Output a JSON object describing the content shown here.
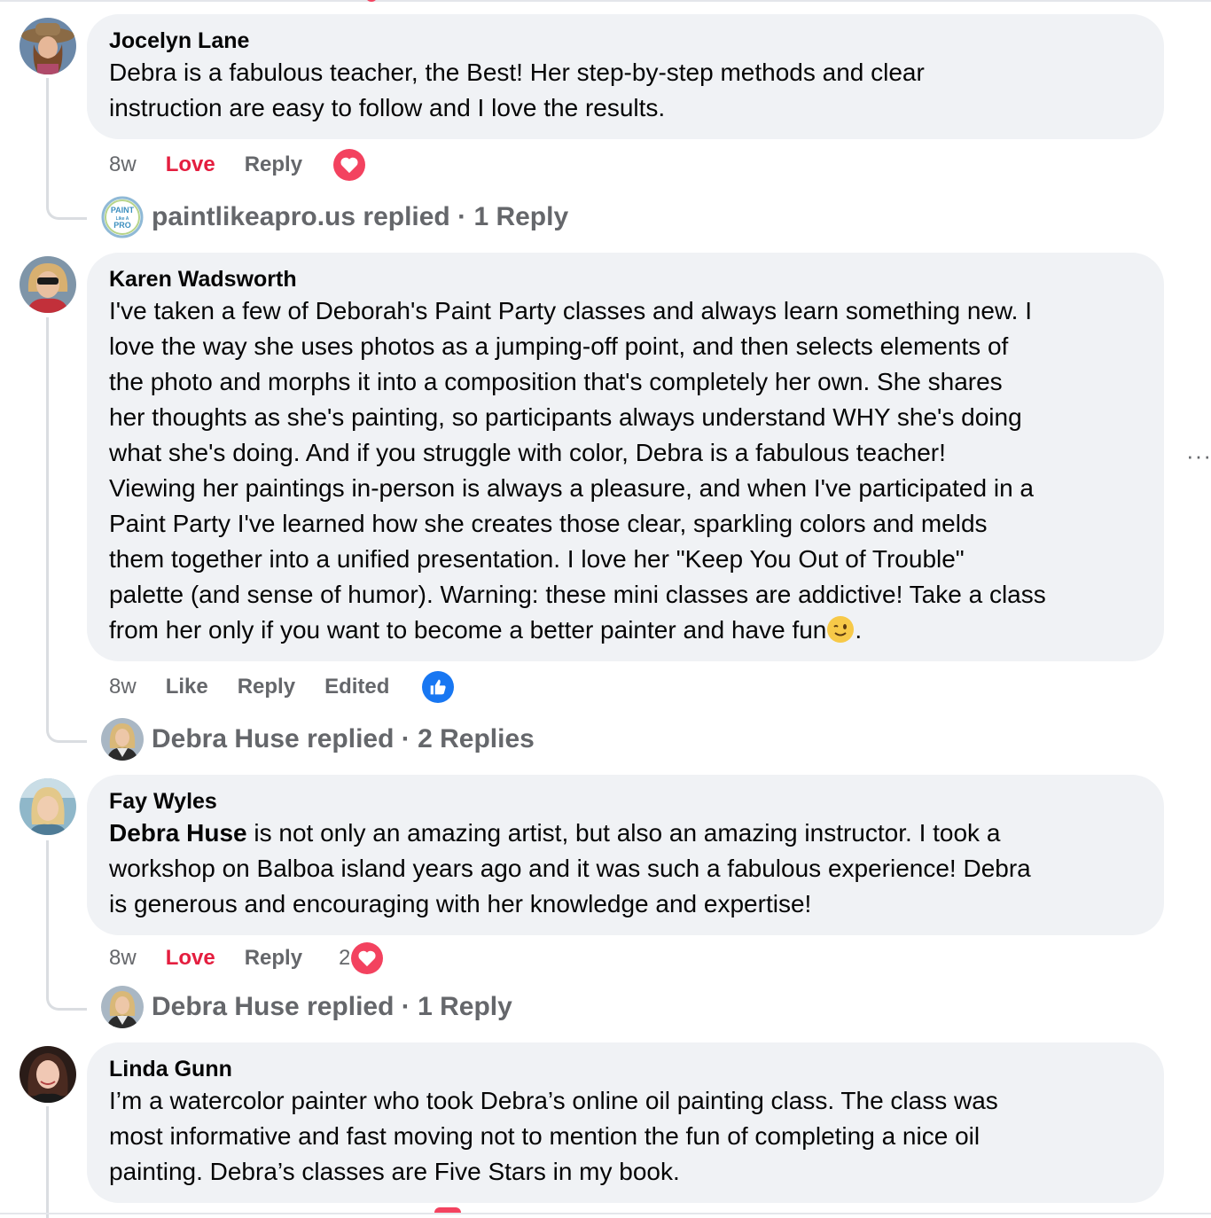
{
  "comments": [
    {
      "author": "Jocelyn Lane",
      "text": "Debra is a fabulous teacher, the Best! Her step-by-step methods and clear\ninstruction are easy to follow and I love the results.",
      "time": "8w",
      "reaction_action": "Love",
      "reply_action": "Reply",
      "reaction_icon": "heart",
      "reaction_count": "",
      "replied_by": "paintlikeapro.us replied",
      "reply_count": "1 Reply"
    },
    {
      "author": "Karen Wadsworth",
      "text": "I've taken a few of Deborah's Paint Party classes and always learn something new. I\nlove the way she uses photos as a jumping-off point, and then selects elements of\nthe photo and morphs it into a composition that's completely her own. She shares\nher thoughts as she's painting, so participants always understand WHY she's doing\nwhat she's doing. And if you struggle with color, Debra is a fabulous teacher!\nViewing her paintings in-person is always a pleasure, and when I've participated in a\nPaint Party I've learned how she creates those clear, sparkling colors and melds\nthem together into a unified presentation. I love her \"Keep You Out of Trouble\"\npalette (and sense of humor). Warning: these mini classes are addictive! Take a class\nfrom her only if you want to become a better painter and have fun",
      "text_end": ".",
      "time": "8w",
      "reaction_action": "Like",
      "reply_action": "Reply",
      "edited": "Edited",
      "reaction_icon": "thumbs-up",
      "reaction_count": "",
      "replied_by": "Debra Huse replied",
      "reply_count": "2 Replies"
    },
    {
      "author": "Fay Wyles",
      "mention": "Debra Huse",
      "text": " is not only an amazing artist, but also an amazing instructor. I took a\nworkshop on Balboa island years ago and it was such a fabulous experience! Debra\nis generous and encouraging with her knowledge and expertise!",
      "time": "8w",
      "reaction_action": "Love",
      "reply_action": "Reply",
      "reaction_icon": "heart",
      "reaction_count": "2",
      "replied_by": "Debra Huse replied",
      "reply_count": "1 Reply"
    },
    {
      "author": "Linda Gunn",
      "text": "I’m a watercolor painter who took Debra’s online oil painting class. The class was\nmost informative and fast moving not to mention the fun of completing a nice oil\npainting. Debra’s classes are Five Stars in my book."
    }
  ],
  "separator": " · ",
  "more_menu": "···",
  "paintlikeapro_logo_text": [
    "PAINT",
    "Like A",
    "PRO"
  ],
  "colors": {
    "bubble": "#f0f2f5",
    "love": "#e41e3f",
    "like": "#1877f2",
    "secondary_text": "#65676b"
  }
}
